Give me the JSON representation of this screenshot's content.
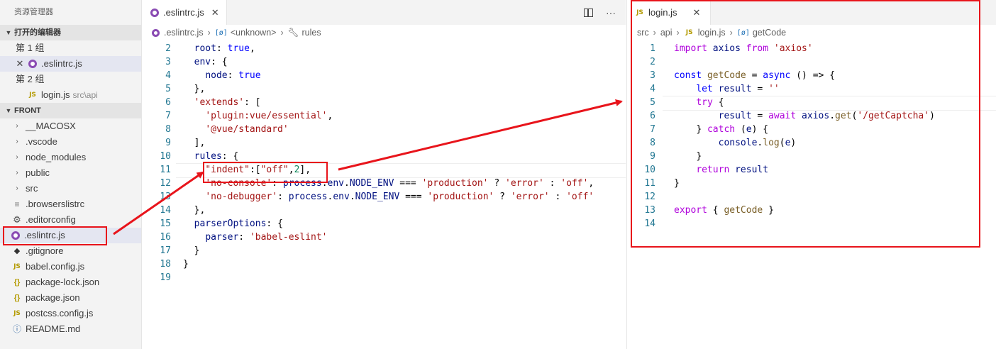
{
  "explorer": {
    "title": "资源管理器",
    "open_editors_label": "打开的编辑器",
    "group1_label": "第 1 组",
    "group1_file": ".eslintrc.js",
    "group2_label": "第 2 组",
    "group2_file": "login.js",
    "group2_path": "src\\api",
    "folder_label": "FRONT",
    "items": [
      {
        "label": "__MACOSX",
        "kind": "folder"
      },
      {
        "label": ".vscode",
        "kind": "folder"
      },
      {
        "label": "node_modules",
        "kind": "folder"
      },
      {
        "label": "public",
        "kind": "folder"
      },
      {
        "label": "src",
        "kind": "folder"
      },
      {
        "label": ".browserslistrc",
        "kind": "text"
      },
      {
        "label": ".editorconfig",
        "kind": "gear"
      },
      {
        "label": ".eslintrc.js",
        "kind": "eslint"
      },
      {
        "label": ".gitignore",
        "kind": "git"
      },
      {
        "label": "babel.config.js",
        "kind": "js"
      },
      {
        "label": "package-lock.json",
        "kind": "json"
      },
      {
        "label": "package.json",
        "kind": "json"
      },
      {
        "label": "postcss.config.js",
        "kind": "js"
      },
      {
        "label": "README.md",
        "kind": "info"
      }
    ]
  },
  "left_editor": {
    "tab_label": ".eslintrc.js",
    "breadcrumbs": [
      ".eslintrc.js",
      "<unknown>",
      "rules"
    ],
    "line_numbers": [
      "2",
      "3",
      "4",
      "5",
      "6",
      "7",
      "8",
      "9",
      "10",
      "11",
      "12",
      "13",
      "14",
      "15",
      "16",
      "17",
      "18",
      "19"
    ],
    "lines": [
      "  root: true,",
      "  env: {",
      "    node: true",
      "  },",
      "  'extends': [",
      "    'plugin:vue/essential',",
      "    '@vue/standard'",
      "  ],",
      "  rules: {",
      "    \"indent\":[\"off\",2],",
      "    'no-console': process.env.NODE_ENV === 'production' ? 'error' : 'off',",
      "    'no-debugger': process.env.NODE_ENV === 'production' ? 'error' : 'off'",
      "  },",
      "  parserOptions: {",
      "    parser: 'babel-eslint'",
      "  }",
      "}",
      ""
    ]
  },
  "right_editor": {
    "tab_label": "login.js",
    "breadcrumbs": [
      "src",
      "api",
      "login.js",
      "getCode"
    ],
    "line_numbers": [
      "1",
      "2",
      "3",
      "4",
      "5",
      "6",
      "7",
      "8",
      "9",
      "10",
      "11",
      "12",
      "13",
      "14"
    ],
    "lines": [
      "import axios from 'axios'",
      "",
      "const getCode = async () => {",
      "    let result = ''",
      "    try {",
      "        result = await axios.get('/getCaptcha')",
      "    } catch (e) {",
      "        console.log(e)",
      "    }",
      "    return result",
      "}",
      "",
      "export { getCode }",
      ""
    ]
  },
  "icons": {
    "js": "JS",
    "json": "{ }",
    "close": "×",
    "more": "···",
    "chevron_right": "›",
    "chevron_down": "⌄"
  },
  "colors": {
    "annotation_red": "#e8141b",
    "eslint_purple": "#8a4bb3",
    "js_yellow": "#b39a00",
    "sidebar_bg": "#f3f3f3",
    "selected_bg": "#e4e6f1"
  }
}
